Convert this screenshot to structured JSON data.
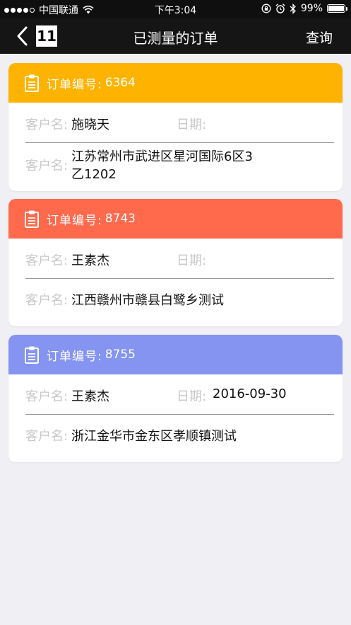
{
  "status_bar": {
    "carrier": "中国联通",
    "time": "下午3:04",
    "battery": "99%",
    "battery_level": 0.99
  },
  "nav": {
    "title": "已测量的订单",
    "logo": "11",
    "query_label": "查询"
  },
  "labels": {
    "order_no": "订单编号:",
    "customer": "客户名:",
    "date": "日期:"
  },
  "orders": [
    {
      "color": "#fdb300",
      "order_no": "6364",
      "customer": "施晓天",
      "date": "",
      "address_line1": "江苏常州市武进区星河国际6区3",
      "address_line2": "乙1202"
    },
    {
      "color": "#ff6a4d",
      "order_no": "8743",
      "customer": "王素杰",
      "date": "",
      "address_line1": "江西赣州市赣县白鹭乡测试",
      "address_line2": ""
    },
    {
      "color": "#8494f0",
      "order_no": "8755",
      "customer": "王素杰",
      "date": "2016-09-30",
      "address_line1": "浙江金华市金东区孝顺镇测试",
      "address_line2": ""
    }
  ]
}
